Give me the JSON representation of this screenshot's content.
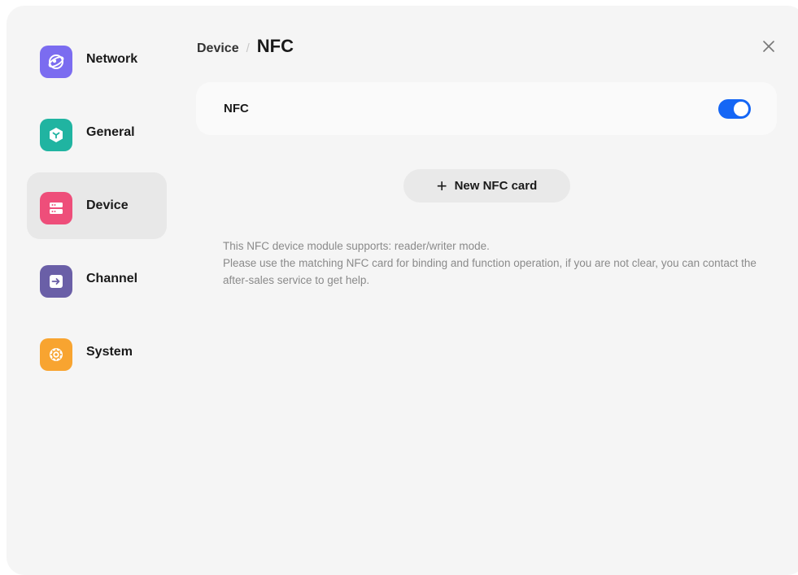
{
  "sidebar": {
    "items": [
      {
        "label": "Network",
        "icon": "globe-icon",
        "color": "#7b6cf0",
        "active": false
      },
      {
        "label": "General",
        "icon": "cube-icon",
        "color": "#20b4a1",
        "active": false
      },
      {
        "label": "Device",
        "icon": "device-icon",
        "color": "#ee4e7a",
        "active": true
      },
      {
        "label": "Channel",
        "icon": "input-icon",
        "color": "#6a5fa7",
        "active": false
      },
      {
        "label": "System",
        "icon": "settings-icon",
        "color": "#f8a430",
        "active": false
      }
    ]
  },
  "header": {
    "parent": "Device",
    "separator": "/",
    "current": "NFC",
    "close_icon": "close-icon"
  },
  "nfc_setting": {
    "label": "NFC",
    "enabled": true,
    "toggle_color": "#1566f5"
  },
  "new_card_button": {
    "plus": "+",
    "label": "New NFC card"
  },
  "help_text": {
    "line1": "This NFC device module supports: reader/writer mode.",
    "line2": "Please use the matching NFC card for binding and function operation, if you are not clear, you can contact the after-sales service to get help."
  }
}
